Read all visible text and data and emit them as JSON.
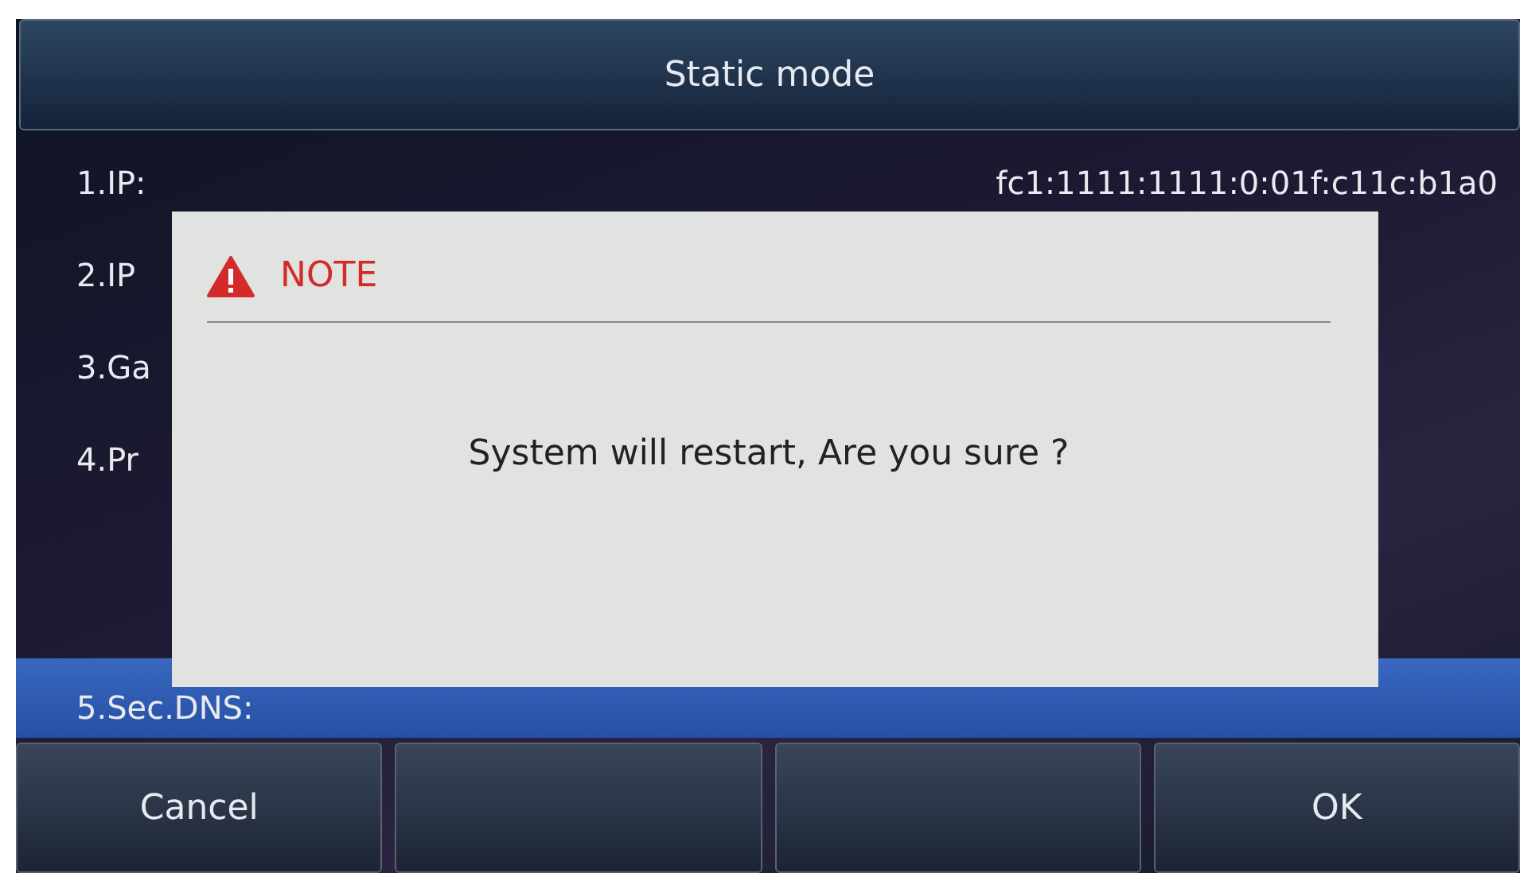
{
  "header": {
    "title": "Static mode"
  },
  "rows": [
    {
      "label": "1.IP:",
      "value": "fc1:1111:1111:0:01f:c11c:b1a0",
      "selected": false
    },
    {
      "label": "2.IP",
      "selected": false
    },
    {
      "label": "3.Ga",
      "selected": false
    },
    {
      "label": "4.Pr",
      "selected": false
    },
    {
      "label": "5.Sec.DNS:",
      "selected": true
    }
  ],
  "softkeys": [
    {
      "kind": "text",
      "label": "Cancel"
    },
    {
      "kind": "blank"
    },
    {
      "kind": "blank"
    },
    {
      "kind": "text",
      "label": "OK"
    }
  ],
  "dialog": {
    "title": "NOTE",
    "message": "System will restart, Are you sure ?"
  }
}
